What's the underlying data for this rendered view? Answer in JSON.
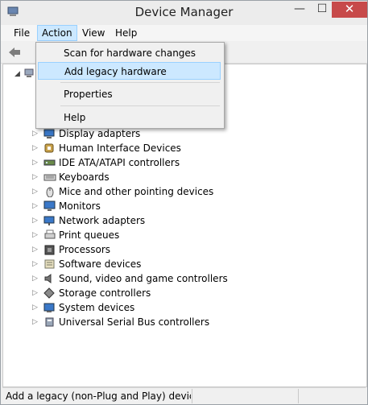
{
  "window": {
    "title": "Device Manager",
    "controls": {
      "minimize": "—",
      "maximize": "☐",
      "close": "✕"
    }
  },
  "menubar": {
    "file": "File",
    "action": "Action",
    "view": "View",
    "help": "Help"
  },
  "action_menu": {
    "items": [
      "Scan for hardware changes",
      "Add legacy hardware",
      "Properties",
      "Help"
    ],
    "highlighted": "Add legacy hardware"
  },
  "tree": {
    "root_expander": "◢",
    "expander": "▷",
    "items": [
      {
        "label": "Display adapters",
        "icon": "display-adapter-icon"
      },
      {
        "label": "Human Interface Devices",
        "icon": "hid-icon"
      },
      {
        "label": "IDE ATA/ATAPI controllers",
        "icon": "ide-controller-icon"
      },
      {
        "label": "Keyboards",
        "icon": "keyboard-icon"
      },
      {
        "label": "Mice and other pointing devices",
        "icon": "mouse-icon"
      },
      {
        "label": "Monitors",
        "icon": "monitor-icon"
      },
      {
        "label": "Network adapters",
        "icon": "network-adapter-icon"
      },
      {
        "label": "Print queues",
        "icon": "printer-icon"
      },
      {
        "label": "Processors",
        "icon": "processor-icon"
      },
      {
        "label": "Software devices",
        "icon": "software-device-icon"
      },
      {
        "label": "Sound, video and game controllers",
        "icon": "speaker-icon"
      },
      {
        "label": "Storage controllers",
        "icon": "storage-controller-icon"
      },
      {
        "label": "System devices",
        "icon": "system-device-icon"
      },
      {
        "label": "Universal Serial Bus controllers",
        "icon": "usb-icon"
      }
    ]
  },
  "status_bar": {
    "text": "Add a legacy (non-Plug and Play) device to"
  },
  "colors": {
    "menu_highlight": "#cce8ff",
    "menu_highlight_border": "#99d1ff",
    "close_button": "#c74a4a"
  }
}
